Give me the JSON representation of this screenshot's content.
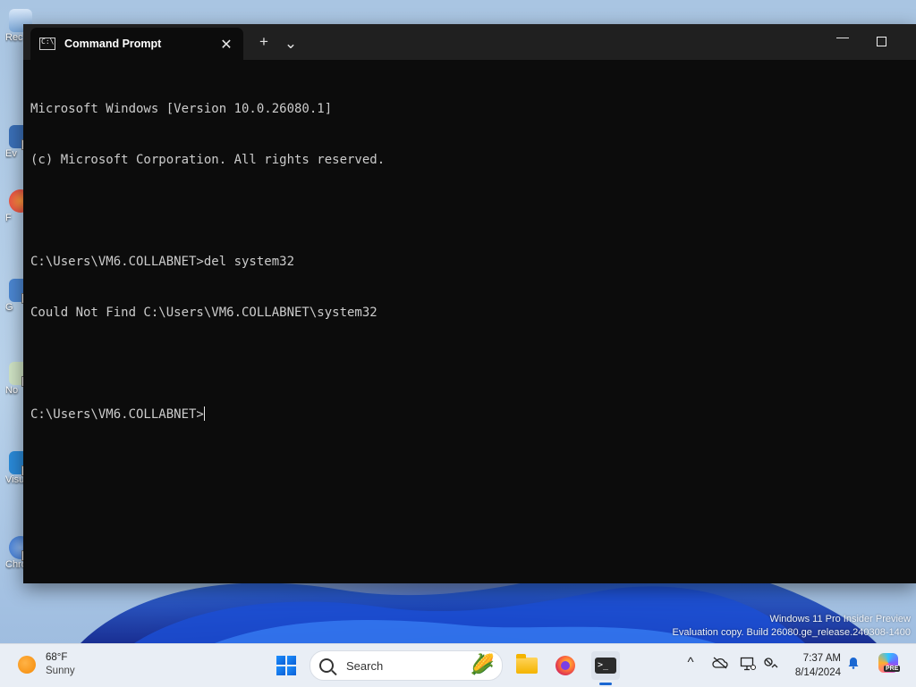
{
  "desktop": {
    "icons": [
      {
        "label": "Rec"
      },
      {
        "label": "Ev"
      },
      {
        "label": "F"
      },
      {
        "label": "G"
      },
      {
        "label": "No"
      },
      {
        "label": "Visu"
      },
      {
        "label": "Chromium"
      }
    ],
    "watermark_line1": "Windows 11 Pro Insider Preview",
    "watermark_line2": "Evaluation copy. Build 26080.ge_release.240308-1400"
  },
  "terminal": {
    "tab_title": "Command Prompt",
    "tab_icon_text": "C:\\",
    "close_glyph": "✕",
    "new_tab_glyph": "+",
    "dropdown_glyph": "⌄",
    "minimize_glyph": "—",
    "lines": [
      "Microsoft Windows [Version 10.0.26080.1]",
      "(c) Microsoft Corporation. All rights reserved.",
      "",
      "C:\\Users\\VM6.COLLABNET>del system32",
      "Could Not Find C:\\Users\\VM6.COLLABNET\\system32",
      "",
      "C:\\Users\\VM6.COLLABNET>"
    ]
  },
  "taskbar": {
    "weather_temp": "68°F",
    "weather_desc": "Sunny",
    "search_placeholder": "Search",
    "search_art": "🌽",
    "tray_chevron": "^",
    "clock_time": "7:37 AM",
    "clock_date": "8/14/2024",
    "copilot_badge": "PRE",
    "tray_icons": [
      "cloud-offline-icon",
      "display-icon",
      "network-icon"
    ]
  }
}
